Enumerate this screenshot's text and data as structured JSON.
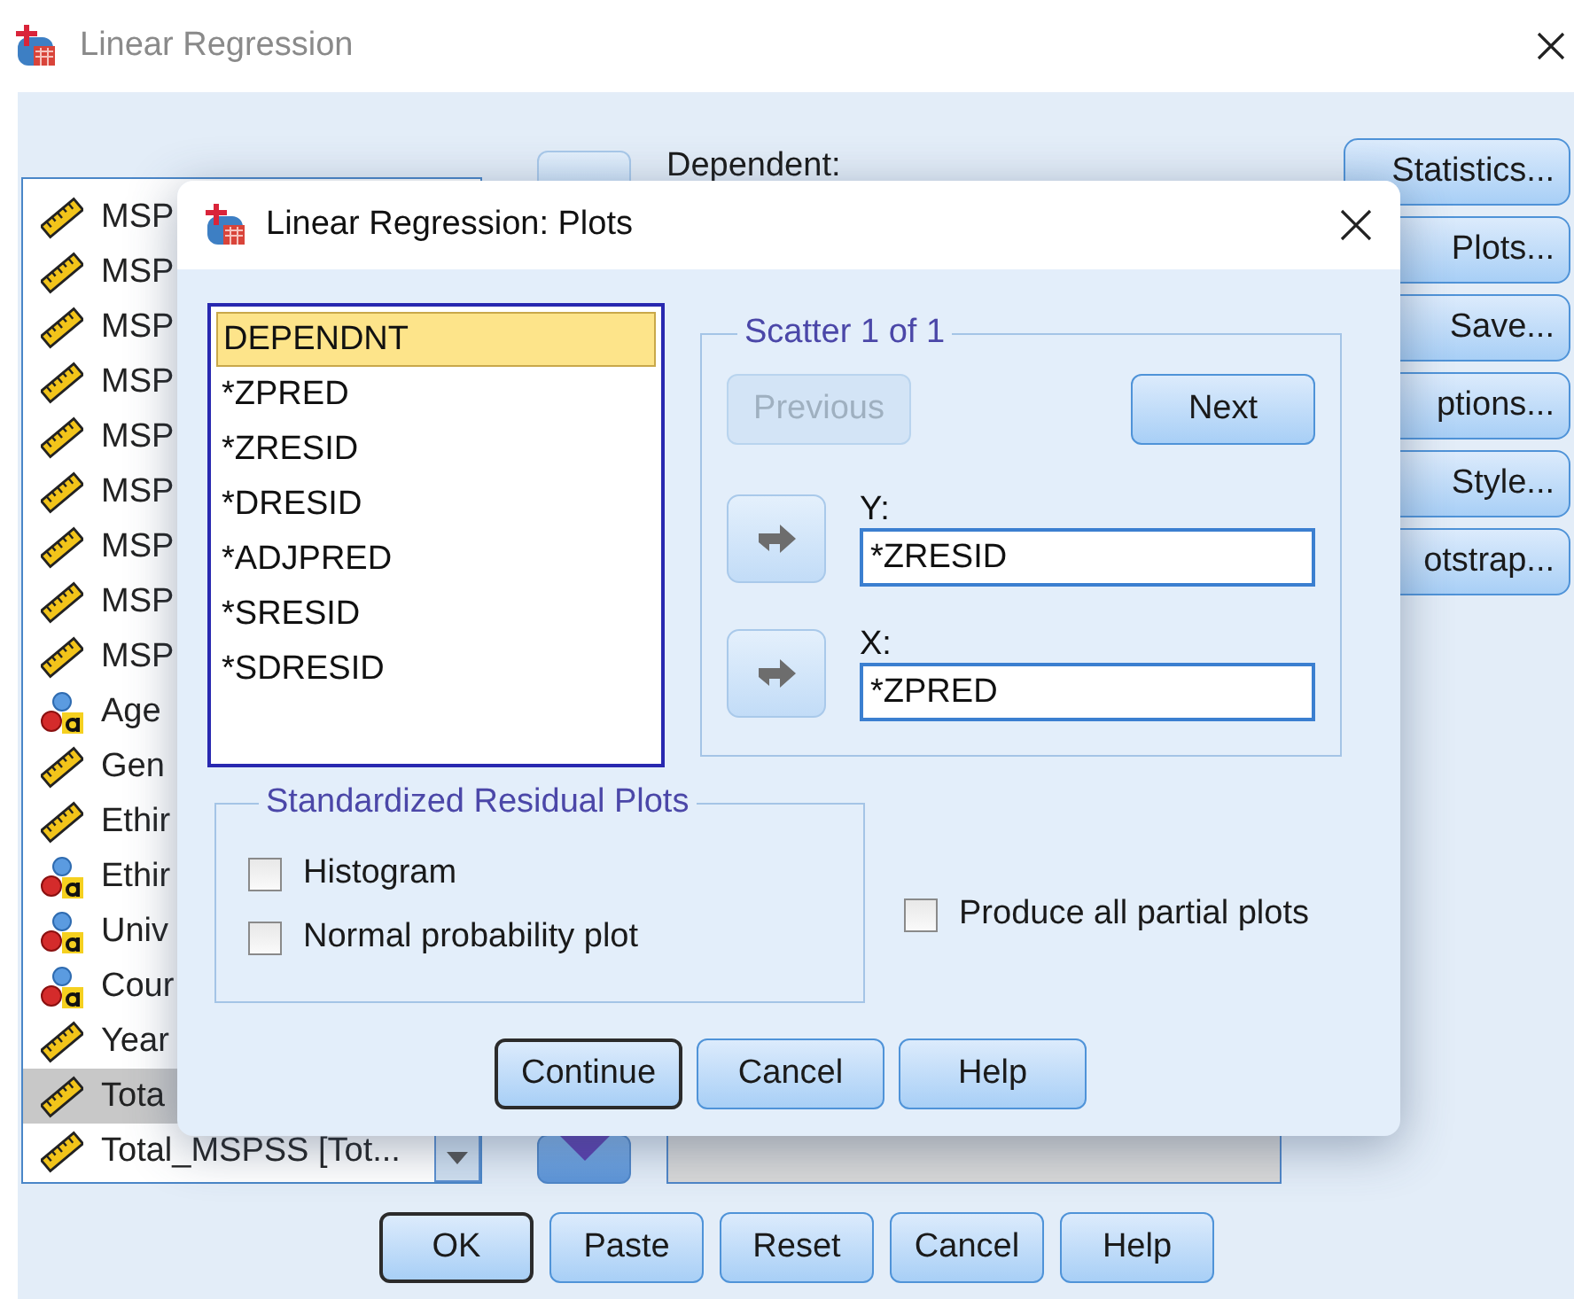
{
  "main_window": {
    "title": "Linear Regression",
    "variables": [
      {
        "label": "MSP",
        "kind": "scale",
        "selected": false
      },
      {
        "label": "MSP",
        "kind": "scale",
        "selected": false
      },
      {
        "label": "MSP",
        "kind": "scale",
        "selected": false
      },
      {
        "label": "MSP",
        "kind": "scale",
        "selected": false
      },
      {
        "label": "MSP",
        "kind": "scale",
        "selected": false
      },
      {
        "label": "MSP",
        "kind": "scale",
        "selected": false
      },
      {
        "label": "MSP",
        "kind": "scale",
        "selected": false
      },
      {
        "label": "MSP",
        "kind": "scale",
        "selected": false
      },
      {
        "label": "MSP",
        "kind": "scale",
        "selected": false
      },
      {
        "label": "Age",
        "kind": "nominal",
        "selected": false
      },
      {
        "label": "Gen",
        "kind": "scale",
        "selected": false
      },
      {
        "label": "Ethir",
        "kind": "scale",
        "selected": false
      },
      {
        "label": "Ethir",
        "kind": "nominal",
        "selected": false
      },
      {
        "label": "Univ",
        "kind": "nominal",
        "selected": false
      },
      {
        "label": "Cour",
        "kind": "nominal",
        "selected": false
      },
      {
        "label": "Year",
        "kind": "scale",
        "selected": false
      },
      {
        "label": "Tota",
        "kind": "scale",
        "selected": true
      },
      {
        "label": "Total_MSPSS [Tot...",
        "kind": "scale",
        "selected": false
      }
    ],
    "dependent_label": {
      "text": "Dependent:"
    },
    "side_buttons": [
      {
        "label": "Statistics..."
      },
      {
        "label": "Plots..."
      },
      {
        "label": "Save..."
      },
      {
        "label": "ptions..."
      },
      {
        "label": "Style..."
      },
      {
        "label": "otstrap..."
      }
    ],
    "bottom_buttons": [
      {
        "label": "OK",
        "default": true
      },
      {
        "label": "Paste",
        "default": false
      },
      {
        "label": "Reset",
        "default": false
      },
      {
        "label": "Cancel",
        "default": false
      },
      {
        "label": "Help",
        "default": false
      }
    ]
  },
  "plots_dialog": {
    "title": "Linear Regression: Plots",
    "source_list": [
      {
        "label": "DEPENDNT",
        "selected": true
      },
      {
        "label": "*ZPRED",
        "selected": false
      },
      {
        "label": "*ZRESID",
        "selected": false
      },
      {
        "label": "*DRESID",
        "selected": false
      },
      {
        "label": "*ADJPRED",
        "selected": false
      },
      {
        "label": "*SRESID",
        "selected": false
      },
      {
        "label": "*SDRESID",
        "selected": false
      }
    ],
    "scatter": {
      "legend": "Scatter 1 of 1",
      "previous": {
        "label": "Previous",
        "disabled": true
      },
      "next": {
        "label": "Next",
        "disabled": false
      },
      "axes": [
        {
          "label": "Y:",
          "value": "*ZRESID"
        },
        {
          "label": "X:",
          "value": "*ZPRED"
        }
      ]
    },
    "residual_group": {
      "legend": "Standardized Residual Plots",
      "options": [
        {
          "label": "Histogram",
          "checked": false
        },
        {
          "label": "Normal probability plot",
          "checked": false
        }
      ]
    },
    "partial_plots": {
      "label": "Produce all partial plots",
      "checked": false
    },
    "buttons": [
      {
        "label": "Continue",
        "default": true
      },
      {
        "label": "Cancel",
        "default": false
      },
      {
        "label": "Help",
        "default": false
      }
    ]
  }
}
